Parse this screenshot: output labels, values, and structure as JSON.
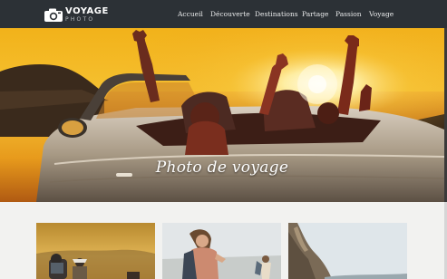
{
  "brand": {
    "name": "VOYAGE",
    "tagline": "PHOTO"
  },
  "nav": {
    "items": [
      {
        "label": "Accueil"
      },
      {
        "label": "Découverte"
      },
      {
        "label": "Destinations"
      },
      {
        "label": "Partage"
      },
      {
        "label": "Passion"
      },
      {
        "label": "Voyage"
      }
    ]
  },
  "hero": {
    "title": "Photo de voyage"
  },
  "cards": [
    {
      "image": "hikers-at-sunset-photo"
    },
    {
      "image": "backpacker-woman-photo"
    },
    {
      "image": "rocky-coast-photo"
    }
  ],
  "colors": {
    "navbar": "#2c3136",
    "nav_text": "#e9eaeb",
    "page_background": "#f2f2f0",
    "hero_title": "#ffffff"
  }
}
